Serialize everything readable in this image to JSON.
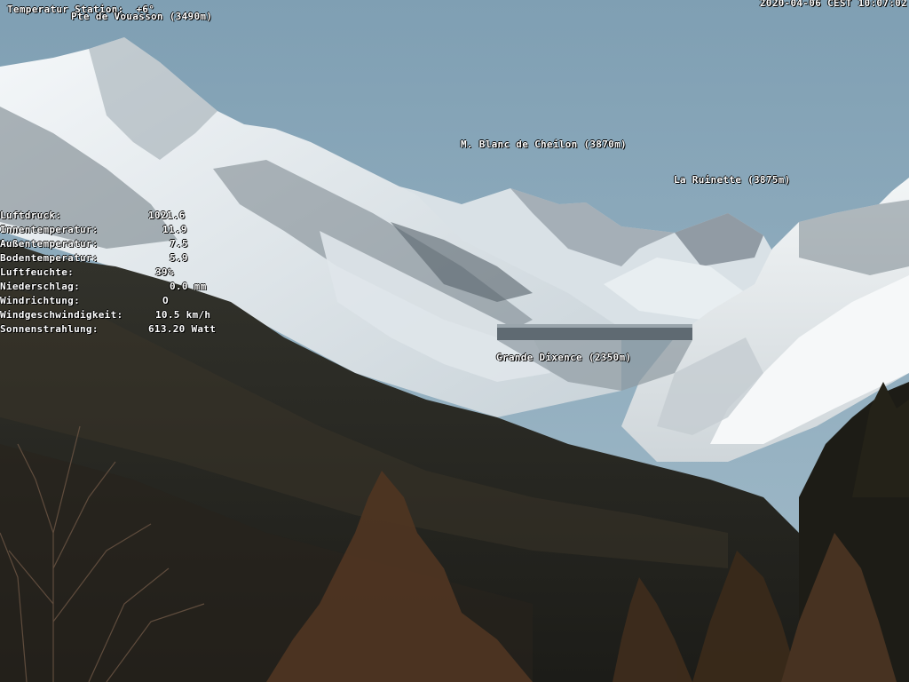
{
  "overlay": {
    "station_temp": "Temperatur Station:  +6°",
    "timestamp": "2020-04-06 CEST 10:07:02"
  },
  "peaks": {
    "vouasson": "Pte de Vouasson (3490m)",
    "cheilon": "M. Blanc de Cheilon (3870m)",
    "ruinette": "La Ruinette (3875m)",
    "dixence": "Grande Dixence (2350m)"
  },
  "weather": [
    {
      "label": "Luftdruck:",
      "value": "1021.6"
    },
    {
      "label": "Innentemperatur:",
      "value": "11.9"
    },
    {
      "label": "Außentemperatur:",
      "value": "7.5"
    },
    {
      "label": "Bodentemperatur:",
      "value": "5.9"
    },
    {
      "label": "Luftfeuchte:",
      "value": "39%"
    },
    {
      "label": "Niederschlag:",
      "value": "0.0 mm"
    },
    {
      "label": "Windrichtung:",
      "value": "O"
    },
    {
      "label": "Windgeschwindigkeit:",
      "value": "10.5 km/h"
    },
    {
      "label": "Sonnenstrahlung:",
      "value": "613.20 Watt"
    }
  ],
  "colors": {
    "sky": "#8fafc1",
    "snow": "#eef3f5",
    "rock": "#5e6a72",
    "forest": "#2a2a24",
    "trees": "#4a3320"
  }
}
